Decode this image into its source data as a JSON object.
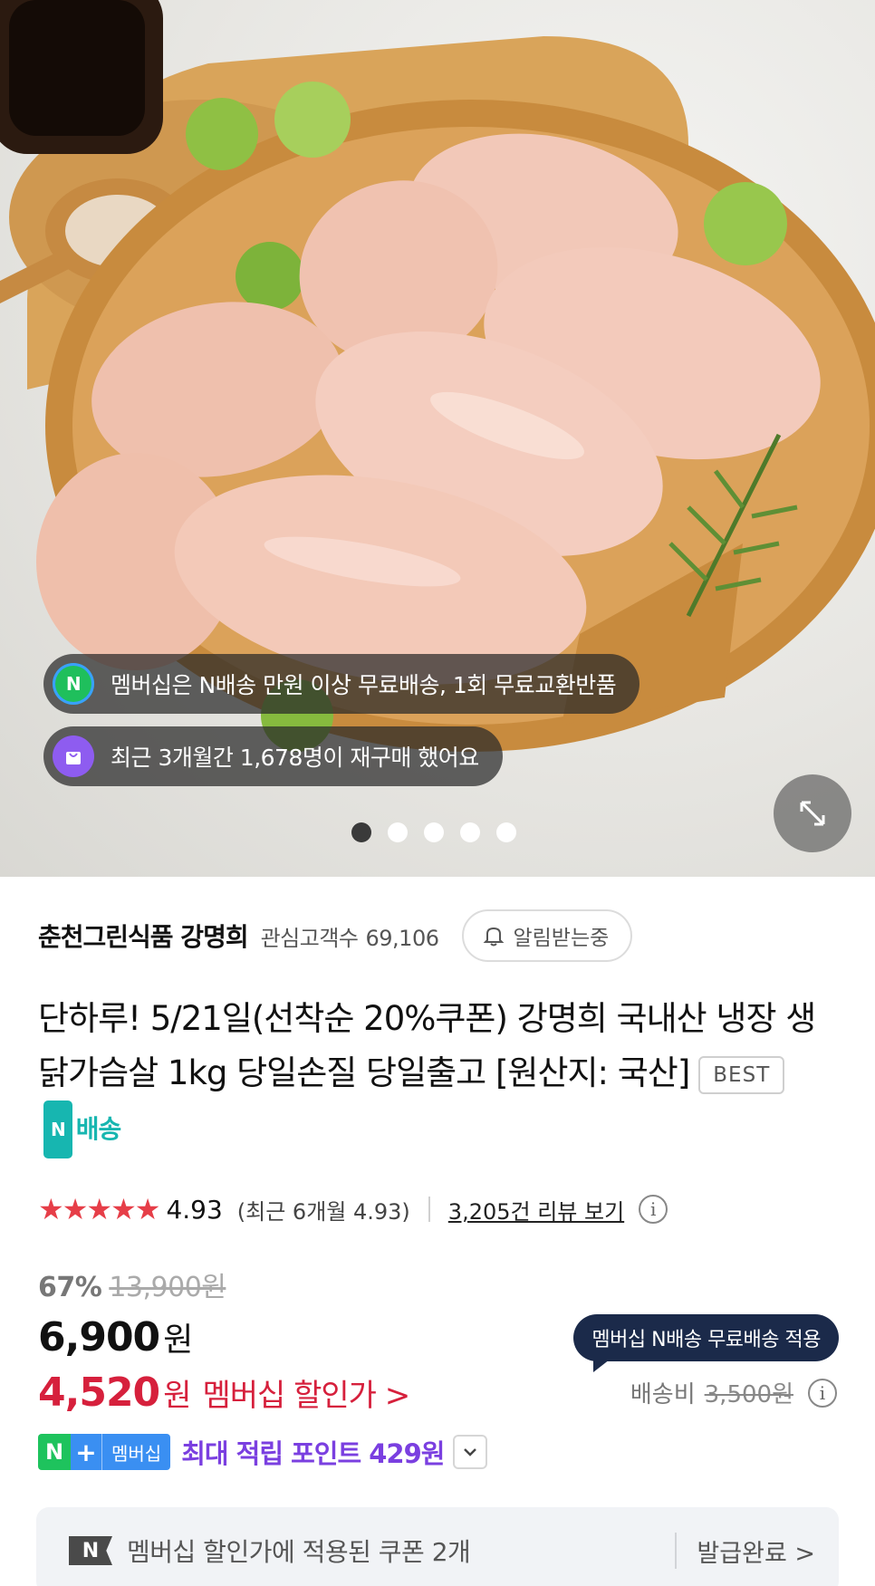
{
  "hero": {
    "membership_notice": "멤버십은 N배송 만원 이상 무료배송, 1회 무료교환반품",
    "membership_icon": "N",
    "repurchase_notice": "최근 3개월간 1,678명이 재구매 했어요",
    "expand_icon": "expand-arrows-icon",
    "image_index": 1,
    "image_count": 5
  },
  "store": {
    "name": "춘천그린식품 강명희",
    "interest_label": "관심고객수",
    "interest_count": "69,106",
    "notify_label": "알림받는중"
  },
  "product": {
    "title": "단하루! 5/21일(선착순 20%쿠폰) 강명희 국내산 냉장 생 닭가슴살 1kg 당일손질 당일출고 [원산지: 국산]",
    "badge_best": "BEST",
    "badge_delivery_box": "N",
    "badge_delivery": "배송"
  },
  "rating": {
    "stars": "★★★★★",
    "score": "4.93",
    "recent": "(최근 6개월 4.93)",
    "review_link": "3,205건 리뷰 보기",
    "info_icon": "i"
  },
  "price": {
    "discount_rate": "67%",
    "original_price": "13,900원",
    "sale_price": "6,900",
    "unit": "원",
    "member_price": "4,520",
    "member_unit": "원",
    "member_label": "멤버십 할인가 >",
    "points_badge_n": "N",
    "points_badge_plus": "+",
    "points_badge_text": "멤버십",
    "points_text": "최대 적립 포인트 429원"
  },
  "shipping": {
    "bubble": "멤버십 N배송 무료배송 적용",
    "fee_label": "배송비",
    "fee_value": "3,500원"
  },
  "coupon": {
    "icon": "N",
    "text": "멤버십 할인가에 적용된 쿠폰 2개",
    "status": "발급완료 >"
  },
  "colors": {
    "accent_red": "#d6203c",
    "star_red": "#e63e48",
    "naver_green": "#1ec35d",
    "membership_blue": "#3a8ff2",
    "points_purple": "#7a3fe0",
    "delivery_teal": "#17b6b0",
    "bubble_navy": "#1b2a4a"
  }
}
